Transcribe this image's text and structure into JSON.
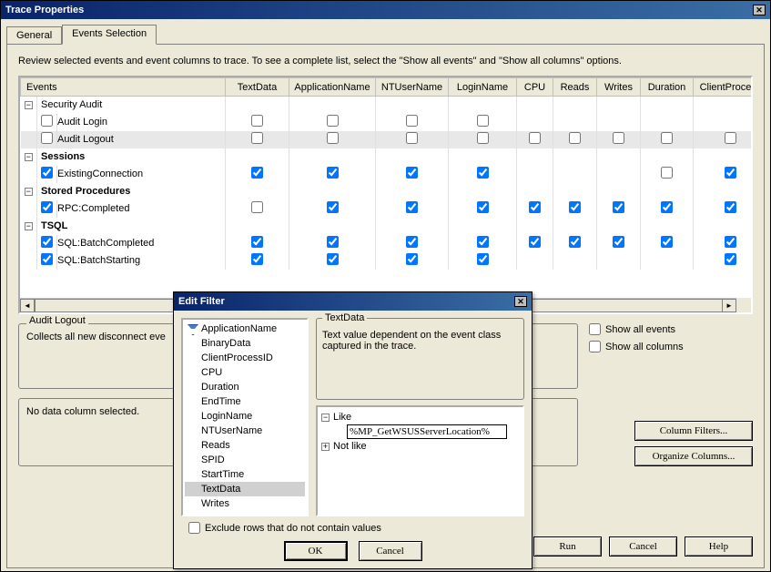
{
  "main": {
    "title": "Trace Properties",
    "tabs": [
      {
        "label": "General",
        "active": false
      },
      {
        "label": "Events Selection",
        "active": true
      }
    ],
    "instruction": "Review selected events and event columns to trace. To see a complete list, select the \"Show all events\" and \"Show all columns\" options.",
    "columns": [
      "Events",
      "TextData",
      "ApplicationName",
      "NTUserName",
      "LoginName",
      "CPU",
      "Reads",
      "Writes",
      "Duration",
      "ClientProcess"
    ],
    "rows": [
      {
        "type": "group",
        "label": "Security Audit",
        "bold": false
      },
      {
        "type": "event",
        "label": "Audit Login",
        "rowChecked": false,
        "cols": [
          false,
          false,
          false,
          false,
          null,
          null,
          null,
          null,
          null
        ],
        "highlighted": false
      },
      {
        "type": "event",
        "label": "Audit Logout",
        "rowChecked": false,
        "cols": [
          false,
          false,
          false,
          false,
          false,
          false,
          false,
          false,
          false
        ],
        "highlighted": true
      },
      {
        "type": "group",
        "label": "Sessions",
        "bold": true
      },
      {
        "type": "event",
        "label": "ExistingConnection",
        "rowChecked": true,
        "cols": [
          true,
          true,
          true,
          true,
          null,
          null,
          null,
          false,
          true
        ],
        "highlighted": false
      },
      {
        "type": "group",
        "label": "Stored Procedures",
        "bold": true
      },
      {
        "type": "event",
        "label": "RPC:Completed",
        "rowChecked": true,
        "cols": [
          false,
          true,
          true,
          true,
          true,
          true,
          true,
          true,
          true
        ],
        "highlighted": false
      },
      {
        "type": "group",
        "label": "TSQL",
        "bold": true
      },
      {
        "type": "event",
        "label": "SQL:BatchCompleted",
        "rowChecked": true,
        "cols": [
          true,
          true,
          true,
          true,
          true,
          true,
          true,
          true,
          true
        ],
        "highlighted": false
      },
      {
        "type": "event",
        "label": "SQL:BatchStarting",
        "rowChecked": true,
        "cols": [
          true,
          true,
          true,
          true,
          null,
          null,
          null,
          null,
          true
        ],
        "highlighted": false
      }
    ],
    "info_event_title": "Audit Logout",
    "info_event_desc": "Collects all new disconnect eve",
    "info_column_desc": "No data column selected.",
    "show_all_events": {
      "label": "Show all events",
      "checked": false
    },
    "show_all_columns": {
      "label": "Show all columns",
      "checked": false
    },
    "btn_column_filters": "Column Filters...",
    "btn_organize_columns": "Organize Columns...",
    "btn_run": "Run",
    "btn_cancel": "Cancel",
    "btn_help": "Help"
  },
  "dialog": {
    "title": "Edit Filter",
    "columns": [
      {
        "name": "ApplicationName",
        "hasFilter": true,
        "selected": false
      },
      {
        "name": "BinaryData",
        "hasFilter": false,
        "selected": false
      },
      {
        "name": "ClientProcessID",
        "hasFilter": false,
        "selected": false
      },
      {
        "name": "CPU",
        "hasFilter": false,
        "selected": false
      },
      {
        "name": "Duration",
        "hasFilter": false,
        "selected": false
      },
      {
        "name": "EndTime",
        "hasFilter": false,
        "selected": false
      },
      {
        "name": "LoginName",
        "hasFilter": false,
        "selected": false
      },
      {
        "name": "NTUserName",
        "hasFilter": false,
        "selected": false
      },
      {
        "name": "Reads",
        "hasFilter": false,
        "selected": false
      },
      {
        "name": "SPID",
        "hasFilter": false,
        "selected": false
      },
      {
        "name": "StartTime",
        "hasFilter": false,
        "selected": false
      },
      {
        "name": "TextData",
        "hasFilter": false,
        "selected": true
      },
      {
        "name": "Writes",
        "hasFilter": false,
        "selected": false
      }
    ],
    "fieldset_label": "TextData",
    "description": "Text value dependent on the event class captured in the trace.",
    "tree": {
      "like_label": "Like",
      "like_value": "%MP_GetWSUSServerLocation%",
      "notlike_label": "Not like"
    },
    "exclude_label": "Exclude rows that do not contain values",
    "exclude_checked": false,
    "btn_ok": "OK",
    "btn_cancel": "Cancel"
  }
}
